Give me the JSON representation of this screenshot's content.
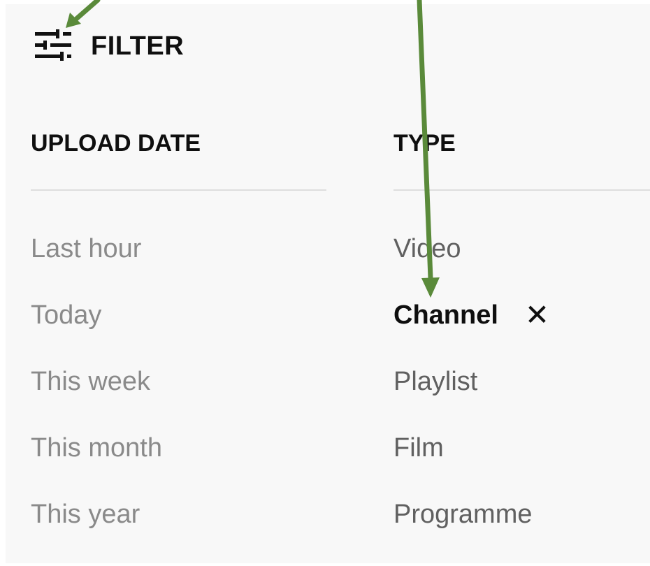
{
  "filter": {
    "icon": "sliders-icon",
    "label": "FILTER"
  },
  "upload_date": {
    "heading": "UPLOAD DATE",
    "options": [
      "Last hour",
      "Today",
      "This week",
      "This month",
      "This year"
    ]
  },
  "type": {
    "heading": "TYPE",
    "options": [
      "Video",
      "Channel",
      "Playlist",
      "Film",
      "Programme"
    ],
    "selected": "Channel",
    "clear_icon": "close-icon",
    "clear_glyph": "✕"
  },
  "colors": {
    "panel_background": "#f8f8f8",
    "annotation_arrow": "#5a8a3a"
  }
}
